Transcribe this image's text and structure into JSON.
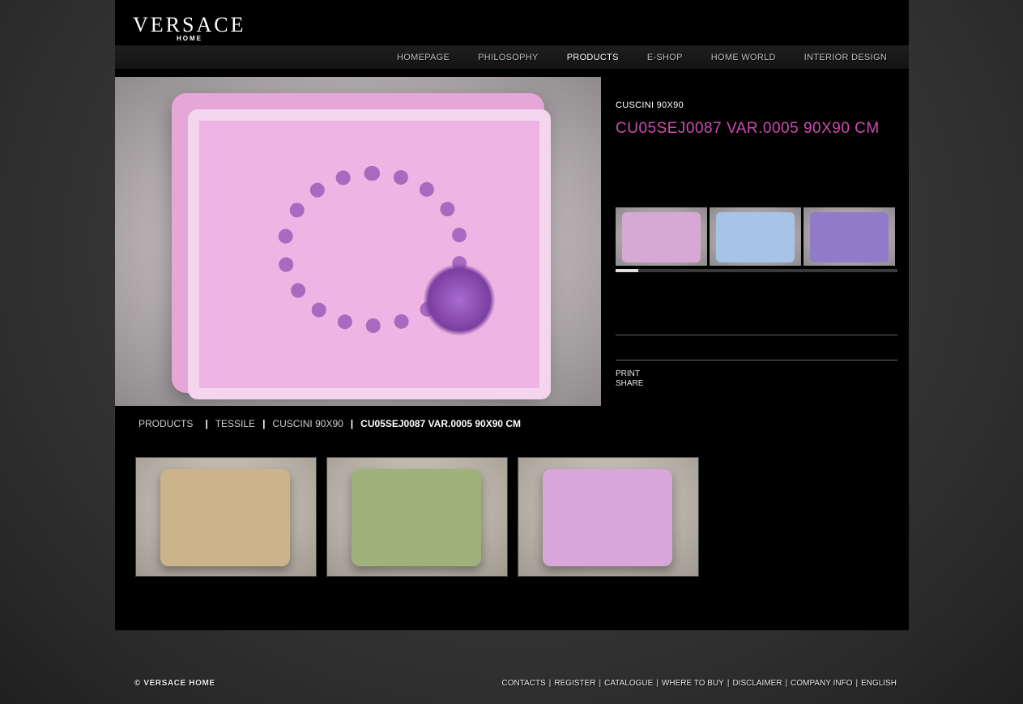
{
  "brand": {
    "name": "VERSACE",
    "sub": "HOME"
  },
  "nav": [
    {
      "label": "HOMEPAGE"
    },
    {
      "label": "PHILOSOPHY"
    },
    {
      "label": "PRODUCTS",
      "active": true
    },
    {
      "label": "E-SHOP"
    },
    {
      "label": "HOME WORLD"
    },
    {
      "label": "INTERIOR DESIGN"
    }
  ],
  "product": {
    "category": "CUSCINI 90X90",
    "code": "CU05SEJ0087 VAR.0005 90X90 CM",
    "accent_color": "#d04ab0"
  },
  "variants": [
    {
      "color": "#d7a8d3"
    },
    {
      "color": "#a7c3e6"
    },
    {
      "color": "#8f7bc8"
    }
  ],
  "variants_scroll": {
    "position": 0
  },
  "actions": {
    "print": "PRINT",
    "share": "SHARE"
  },
  "breadcrumb": {
    "products": "PRODUCTS",
    "tessile": "TESSILE",
    "cuscini": "CUSCINI 90X90",
    "current": "CU05SEJ0087 VAR.0005 90X90 CM",
    "sep": "|"
  },
  "related": [
    {
      "color": "#cbb38a"
    },
    {
      "color": "#9fb27a"
    },
    {
      "color": "#d9a6d9"
    }
  ],
  "footer": {
    "copyright": "© VERSACE HOME",
    "links": [
      "CONTACTS",
      "REGISTER",
      "CATALOGUE",
      "WHERE TO BUY",
      "DISCLAIMER",
      "COMPANY INFO",
      "ENGLISH"
    ],
    "sep": "|"
  }
}
